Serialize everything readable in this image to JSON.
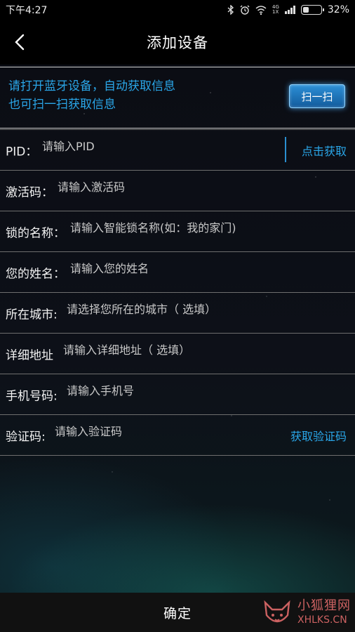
{
  "status_bar": {
    "time": "下午4:27",
    "network_type": "4G",
    "network_sub": "1X",
    "battery_percent": "32%",
    "battery_level": 0.32,
    "icons": [
      "bluetooth-icon",
      "alarm-icon",
      "wifi-icon",
      "signal-icon",
      "battery-icon"
    ]
  },
  "nav": {
    "title": "添加设备",
    "back_icon": "chevron-left-icon"
  },
  "info": {
    "line1": "请打开蓝牙设备，自动获取信息",
    "line2": "也可扫一扫获取信息",
    "scan_label": "扫一扫"
  },
  "form": {
    "pid": {
      "label": "PID：",
      "placeholder": "请输入PID",
      "action": "点击获取"
    },
    "activation": {
      "label": "激活码：",
      "placeholder": "请输入激活码"
    },
    "lock_name": {
      "label": "锁的名称：",
      "placeholder": "请输入智能锁名称(如：我的家门)"
    },
    "your_name": {
      "label": "您的姓名：",
      "placeholder": "请输入您的姓名"
    },
    "city": {
      "label": "所在城市:",
      "placeholder": "请选择您所在的城市（ 选填）"
    },
    "address": {
      "label": "详细地址",
      "placeholder": "请输入详细地址（ 选填）"
    },
    "phone": {
      "label": "手机号码:",
      "placeholder": "请输入手机号"
    },
    "code": {
      "label": "验证码:",
      "placeholder": "请输入验证码",
      "action": "获取验证码"
    }
  },
  "footer": {
    "confirm_label": "确定"
  },
  "watermark": {
    "cn": "小狐狸网",
    "en": "XHLKS.CN"
  },
  "colors": {
    "accent": "#2aa6e8",
    "background": "#000000",
    "watermark": "#e06a6a"
  }
}
